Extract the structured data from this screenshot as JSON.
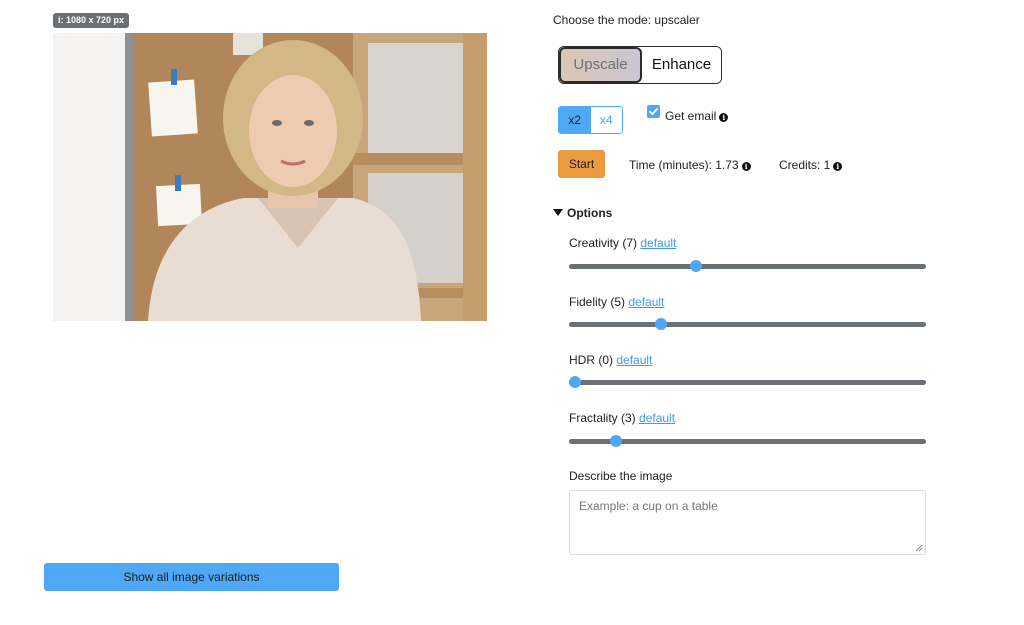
{
  "image": {
    "badge": "i: 1080 x 720 px"
  },
  "variations_button": "Show all image variations",
  "mode_label": "Choose the mode: upscaler",
  "mode_tabs": [
    {
      "label": "Upscale",
      "active": true
    },
    {
      "label": "Enhance",
      "active": false
    }
  ],
  "scale_options": [
    {
      "label": "x2",
      "selected": true
    },
    {
      "label": "x4",
      "selected": false
    }
  ],
  "get_email": {
    "label": "Get email",
    "checked": true
  },
  "start_button": "Start",
  "time_label": "Time (minutes): 1.73",
  "credits_label": "Credits: 1",
  "options": {
    "label": "Options",
    "expanded": true,
    "sliders": [
      {
        "name": "Creativity",
        "label": "Creativity (7)",
        "link": "default",
        "value": 7,
        "min": 0,
        "max": 20
      },
      {
        "name": "Fidelity",
        "label": "Fidelity (5)",
        "link": "default",
        "value": 5,
        "min": 0,
        "max": 20
      },
      {
        "name": "HDR",
        "label": "HDR (0)",
        "link": "default",
        "value": 0,
        "min": 0,
        "max": 20
      },
      {
        "name": "Fractality",
        "label": "Fractality (3)",
        "link": "default",
        "value": 3,
        "min": 0,
        "max": 25
      }
    ]
  },
  "describe": {
    "label": "Describe the image",
    "placeholder": "Example: a cup on a table"
  },
  "colors": {
    "accent": "#4ea8f5",
    "start": "#ec9a3f",
    "track": "#6b7075",
    "link": "#3d9be9"
  }
}
